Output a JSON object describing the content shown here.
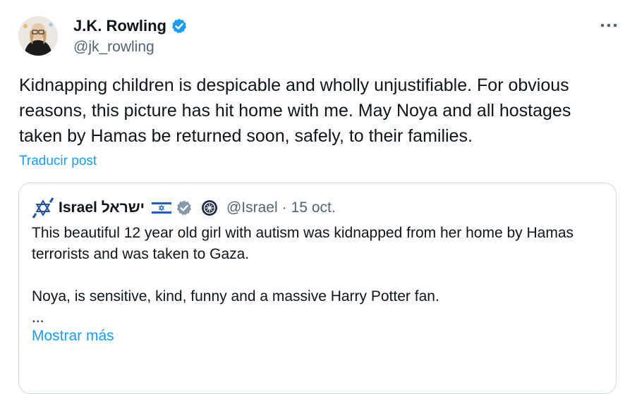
{
  "author": {
    "display_name": "J.K. Rowling",
    "handle": "@jk_rowling",
    "verified": true,
    "avatar_icon": "profile-photo-avatar"
  },
  "tweet": {
    "text": "Kidnapping children is despicable and wholly unjustifiable. For obvious reasons, this picture has hit home with me. May Noya and all hostages taken by Hamas be returned soon, safely, to their families.",
    "translate_label": "Traducir post",
    "more_icon": "more-horizontal-icon"
  },
  "quoted_tweet": {
    "display_name": "Israel ישראל",
    "flag_icon": "israel-flag-icon",
    "verified_badge_icon": "gray-verified-badge-icon",
    "affiliate_badge_icon": "government-emblem-icon",
    "handle": "@Israel",
    "separator": "·",
    "date": "15 oct.",
    "body_line_1": "This beautiful 12 year old girl with autism was kidnapped from her home by Hamas terrorists and was taken to Gaza.",
    "body_line_2": "Noya, is sensitive, kind, funny and a massive Harry Potter fan.",
    "body_line_3": "...",
    "show_more_label": "Mostrar más"
  },
  "colors": {
    "link": "#1d9bf0",
    "secondary_text": "#536471",
    "border": "#cfd9de"
  }
}
